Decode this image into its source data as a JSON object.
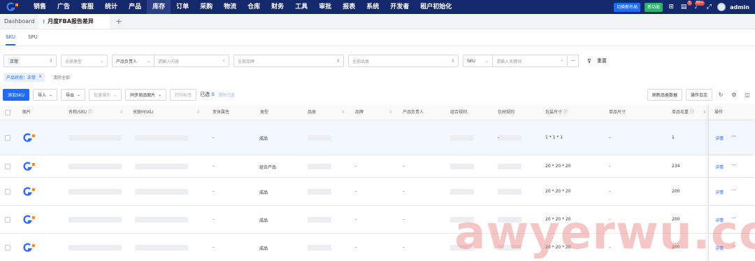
{
  "nav": {
    "items": [
      "销售",
      "广告",
      "客服",
      "统计",
      "产品",
      "库存",
      "订单",
      "采购",
      "物流",
      "仓库",
      "财务",
      "工具",
      "审批",
      "报表",
      "系统",
      "开发者",
      "租户初始化"
    ],
    "active_index": 5,
    "switch_label": "切换新布局",
    "new_feature_label": "新功能",
    "badge_a": "5",
    "badge_b": "99+",
    "username": "admin"
  },
  "tabs": {
    "dashboard": "Dashboard",
    "active": "月度FBA报告差异",
    "add": "+"
  },
  "subtabs": [
    "SKU",
    "SPU"
  ],
  "filters": {
    "status_tag": "正常",
    "type_placeholder": "全部类型",
    "owner_label": "产品负责人",
    "owner_placeholder": "请输入内容",
    "brand_placeholder": "全部品牌",
    "category_placeholder": "全部品类",
    "sku_label": "SKU",
    "sku_placeholder": "请输入关键词",
    "more": "···",
    "reset": "重置"
  },
  "chips": {
    "status": "产品状态：正常",
    "close": "×",
    "clear_all": "清除全部"
  },
  "toolbar": {
    "add_sku": "添加SKU",
    "import": "导入",
    "export": "导出",
    "batch": "批量操作",
    "sync_images": "同步商品图片",
    "print_label": "打印标签",
    "selected_prefix": "已选",
    "selected_count": "0",
    "clear_selected": "清除已选",
    "refresh_category": "刷新品类数据",
    "op_log": "操作日志"
  },
  "columns": {
    "image": "图片",
    "name_sku": "名称/SKU",
    "linked_msku": "关联MSKU",
    "variant": "变体属性",
    "type": "类型",
    "category": "品类",
    "brand": "品牌",
    "owner": "产品负责人",
    "combo_rule": "组合规则",
    "pack_rule": "包材规则",
    "pack_size": "包装尺寸",
    "product_size": "单品尺寸",
    "gross_weight": "单品毛重",
    "action": "操作"
  },
  "rows": [
    {
      "variant": "-",
      "type": "成品",
      "brand": "",
      "owner": "",
      "combo_dash": false,
      "pack_rule": "-",
      "pack_size": "1 * 1 * 1",
      "product_size": "-",
      "gross_weight": "1"
    },
    {
      "variant": "-",
      "type": "组合产品",
      "brand": "-",
      "owner": "-",
      "combo_dash": false,
      "pack_rule": "",
      "pack_size": "20 * 20 * 20",
      "product_size": "-",
      "gross_weight": "234"
    },
    {
      "variant": "-",
      "type": "成品",
      "brand": "-",
      "owner": "-",
      "combo_dash": false,
      "pack_rule": "",
      "pack_size": "20 * 20 * 20",
      "product_size": "-",
      "gross_weight": "200"
    },
    {
      "variant": "-",
      "type": "成品",
      "brand": "-",
      "owner": "-",
      "combo_dash": false,
      "pack_rule": "",
      "pack_size": "20 * 20 * 20",
      "product_size": "-",
      "gross_weight": "200"
    },
    {
      "variant": "-",
      "type": "成品",
      "brand": "-",
      "owner": "-",
      "combo_dash": false,
      "pack_rule": "",
      "pack_size": "20 * 20 * 20",
      "product_size": "-",
      "gross_weight": "200"
    }
  ],
  "row_actions": {
    "detail": "详情",
    "more": "···"
  },
  "watermark": "awyerwu.com",
  "colors": {
    "nav_bg": "#14296b",
    "accent": "#1f6bff",
    "new_badge": "#2bb36b"
  }
}
